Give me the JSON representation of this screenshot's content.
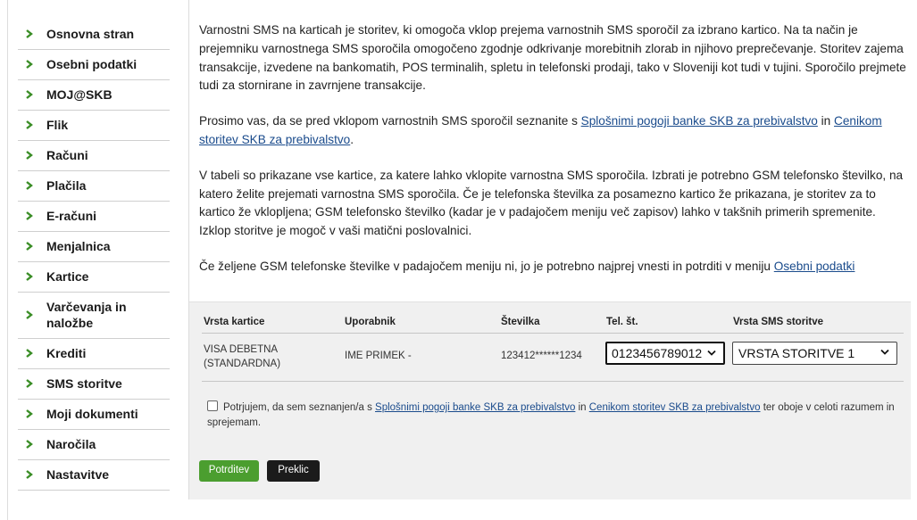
{
  "sidebar": {
    "items": [
      {
        "label": "Osnovna stran"
      },
      {
        "label": "Osebni podatki"
      },
      {
        "label": "MOJ@SKB"
      },
      {
        "label": "Flik"
      },
      {
        "label": "Računi"
      },
      {
        "label": "Plačila"
      },
      {
        "label": "E-računi"
      },
      {
        "label": "Menjalnica"
      },
      {
        "label": "Kartice"
      },
      {
        "label_line1": "Varčevanja in",
        "label_line2": "naložbe"
      },
      {
        "label": "Krediti"
      },
      {
        "label": "SMS storitve"
      },
      {
        "label": "Moji dokumenti"
      },
      {
        "label": "Naročila"
      },
      {
        "label": "Nastavitve"
      }
    ]
  },
  "intro": {
    "p1": "Varnostni SMS na karticah je storitev, ki omogoča vklop prejema varnostnih SMS sporočil za izbrano kartico. Na ta način je prejemniku varnostnega SMS sporočila omogočeno zgodnje odkrivanje morebitnih zlorab in njihovo preprečevanje. Storitev zajema transakcije, izvedene na bankomatih, POS terminalih, spletu in telefonski prodaji, tako v Sloveniji kot tudi v tujini. Sporočilo prejmete tudi za stornirane in zavrnjene transakcije.",
    "p2_before": "Prosimo vas, da se pred vklopom varnostnih SMS sporočil seznanite s ",
    "p2_link1": "Splošnimi pogoji banke SKB za prebivalstvo",
    "p2_mid": " in ",
    "p2_link2": "Cenikom storitev SKB za prebivalstvo",
    "p2_after": ".",
    "p3": "V tabeli so prikazane vse kartice, za katere lahko vklopite varnostna SMS sporočila. Izbrati je potrebno GSM telefonsko številko, na katero želite prejemati varnostna SMS sporočila. Če je telefonska številka za posamezno kartico že prikazana, je storitev za to kartico že vklopljena; GSM telefonsko številko (kadar je v padajočem meniju več zapisov) lahko v takšnih primerih spremenite. Izklop storitve je mogoč v vaši matični poslovalnici.",
    "p4_before": "Če željene GSM telefonske številke v padajočem meniju ni, jo je potrebno najprej vnesti in potrditi v meniju ",
    "p4_link": "Osebni podatki"
  },
  "table": {
    "headers": {
      "card_type": "Vrsta kartice",
      "user": "Uporabnik",
      "number": "Številka",
      "phone": "Tel. št.",
      "sms_type": "Vrsta SMS storitve"
    },
    "rows": [
      {
        "card_type_line1": "VISA DEBETNA",
        "card_type_line2": "(STANDARDNA)",
        "user": "IME PRIMEK -",
        "number": "123412******1234",
        "phone_selected": "0123456789012",
        "sms_type_selected": "VRSTA STORITVE 1"
      }
    ]
  },
  "consent": {
    "before": "Potrjujem, da sem seznanjen/a s ",
    "link1": "Splošnimi pogoji banke SKB za prebivalstvo",
    "mid": " in ",
    "link2": "Cenikom storitev SKB za prebivalstvo",
    "after": " ter oboje v celoti razumem in sprejemam."
  },
  "buttons": {
    "confirm": "Potrditev",
    "cancel": "Preklic"
  },
  "colors": {
    "accent_green": "#4b9e2f",
    "link_blue": "#1a4b8c",
    "panel_bg": "#f0f0f0"
  }
}
